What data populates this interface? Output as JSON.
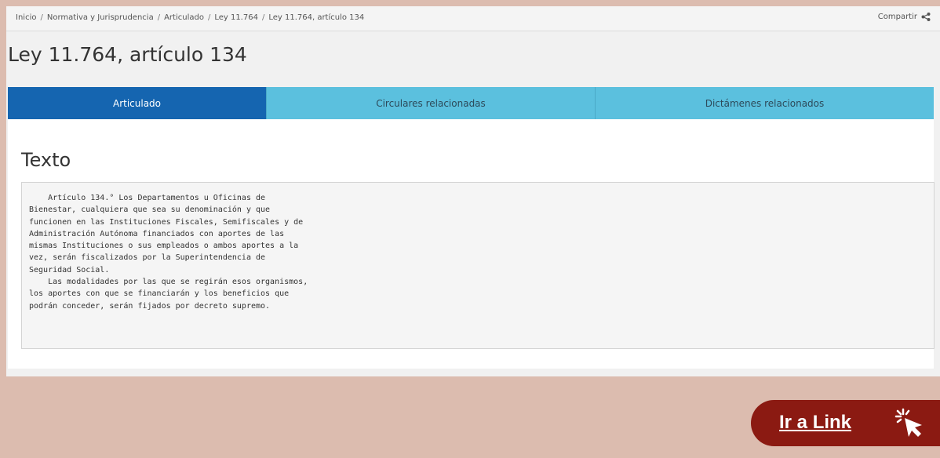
{
  "breadcrumb": {
    "items": [
      "Inicio",
      "Normativa y Jurisprudencia",
      "Articulado",
      "Ley 11.764",
      "Ley 11.764, artículo 134"
    ],
    "separator": "/"
  },
  "share": {
    "label": "Compartir",
    "icon": "share-icon"
  },
  "page_title": "Ley 11.764, artículo 134",
  "tabs": [
    {
      "label": "Articulado",
      "active": true
    },
    {
      "label": "Circulares relacionadas",
      "active": false
    },
    {
      "label": "Dictámenes relacionados",
      "active": false
    }
  ],
  "section": {
    "title": "Texto",
    "body": "    Artículo 134.° Los Departamentos u Oficinas de\nBienestar, cualquiera que sea su denominación y que\nfuncionen en las Instituciones Fiscales, Semifiscales y de\nAdministración Autónoma financiados con aportes de las\nmismas Instituciones o sus empleados o ambos aportes a la\nvez, serán fiscalizados por la Superintendencia de\nSeguridad Social.\n    Las modalidades por las que se regirán esos organismos,\nlos aportes con que se financiarán y los beneficios que\npodrán conceder, serán fijados por decreto supremo."
  },
  "cta": {
    "label": "Ir a Link",
    "icon": "cursor-click-icon"
  },
  "colors": {
    "background": "#dcbcaf",
    "tab_active": "#1565b0",
    "tab_inactive": "#5bc0de",
    "cta": "#8b1a12"
  }
}
